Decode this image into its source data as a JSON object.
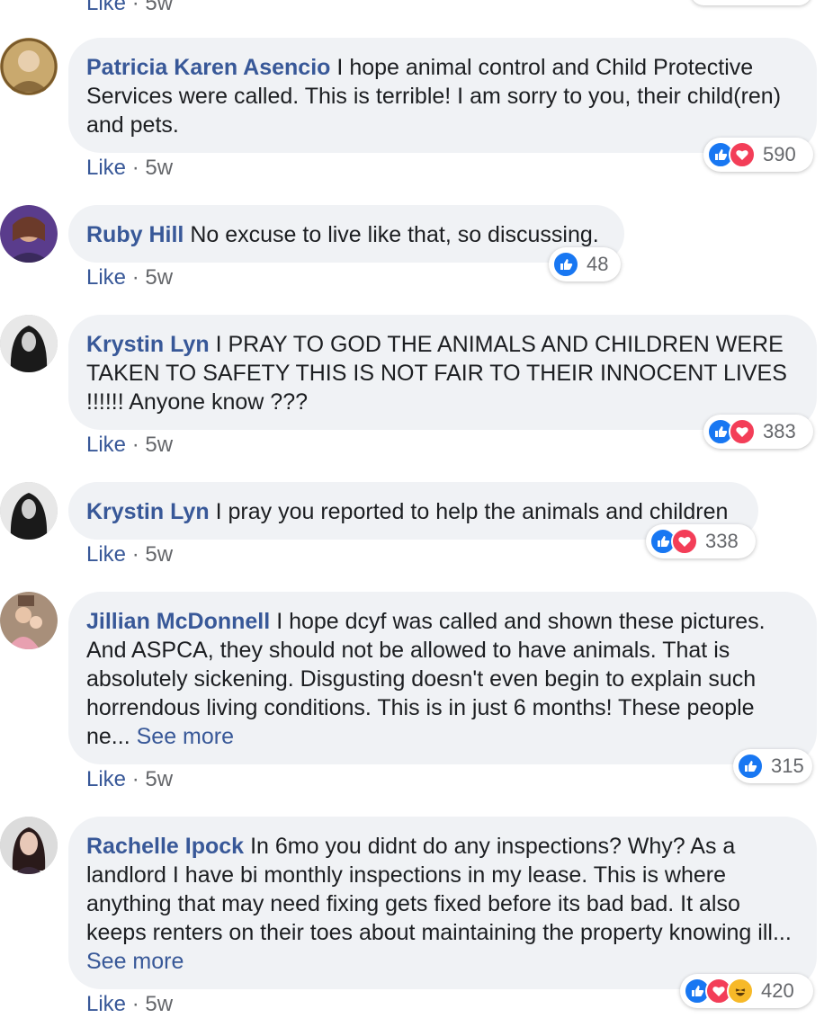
{
  "top_partial": {
    "like": "Like",
    "sep": "·",
    "time": "5w"
  },
  "comments": [
    {
      "author": "Patricia Karen Asencio",
      "text": "I hope animal control and Child Protective Services were called. This is terrible! I am sorry to you, their child(ren) and pets.",
      "like": "Like",
      "sep": "·",
      "time": "5w",
      "reactions": [
        "like",
        "love"
      ],
      "count": "590",
      "see_more": ""
    },
    {
      "author": "Ruby Hill",
      "text": "No excuse to live like that, so discussing.",
      "like": "Like",
      "sep": "·",
      "time": "5w",
      "reactions": [
        "like"
      ],
      "count": "48",
      "see_more": ""
    },
    {
      "author": "Krystin Lyn",
      "text": "I PRAY TO GOD THE ANIMALS AND CHILDREN WERE TAKEN TO SAFETY THIS IS NOT FAIR TO THEIR INNOCENT LIVES !!!!!! Anyone know ???",
      "like": "Like",
      "sep": "·",
      "time": "5w",
      "reactions": [
        "like",
        "love"
      ],
      "count": "383",
      "see_more": ""
    },
    {
      "author": "Krystin Lyn",
      "text": "I pray you reported to help the animals and children",
      "like": "Like",
      "sep": "·",
      "time": "5w",
      "reactions": [
        "like",
        "love"
      ],
      "count": "338",
      "see_more": ""
    },
    {
      "author": "Jillian McDonnell",
      "text": "I hope dcyf was called and shown these pictures. And ASPCA, they should not be allowed to have animals. That is absolutely sickening. Disgusting doesn't even begin to explain such horrendous living conditions. This is in just 6 months! These people ne...",
      "like": "Like",
      "sep": "·",
      "time": "5w",
      "reactions": [
        "like"
      ],
      "count": "315",
      "see_more": "See more"
    },
    {
      "author": "Rachelle Ipock",
      "text": "In 6mo you didnt do any inspections? Why? As a landlord I have bi monthly inspections in my lease. This is where anything that may need fixing gets fixed before its bad bad. It also keeps renters on their toes about maintaining the property knowing ill...",
      "like": "Like",
      "sep": "·",
      "time": "5w",
      "reactions": [
        "like",
        "love",
        "haha"
      ],
      "count": "420",
      "see_more": "See more"
    }
  ],
  "colors": {
    "link": "#385898",
    "bubble": "#f0f2f5",
    "like": "#1877f2",
    "love": "#f33e58",
    "haha": "#f7b928"
  },
  "icons": {
    "like": "thumbs-up-icon",
    "love": "heart-icon",
    "haha": "laughing-face-icon"
  }
}
